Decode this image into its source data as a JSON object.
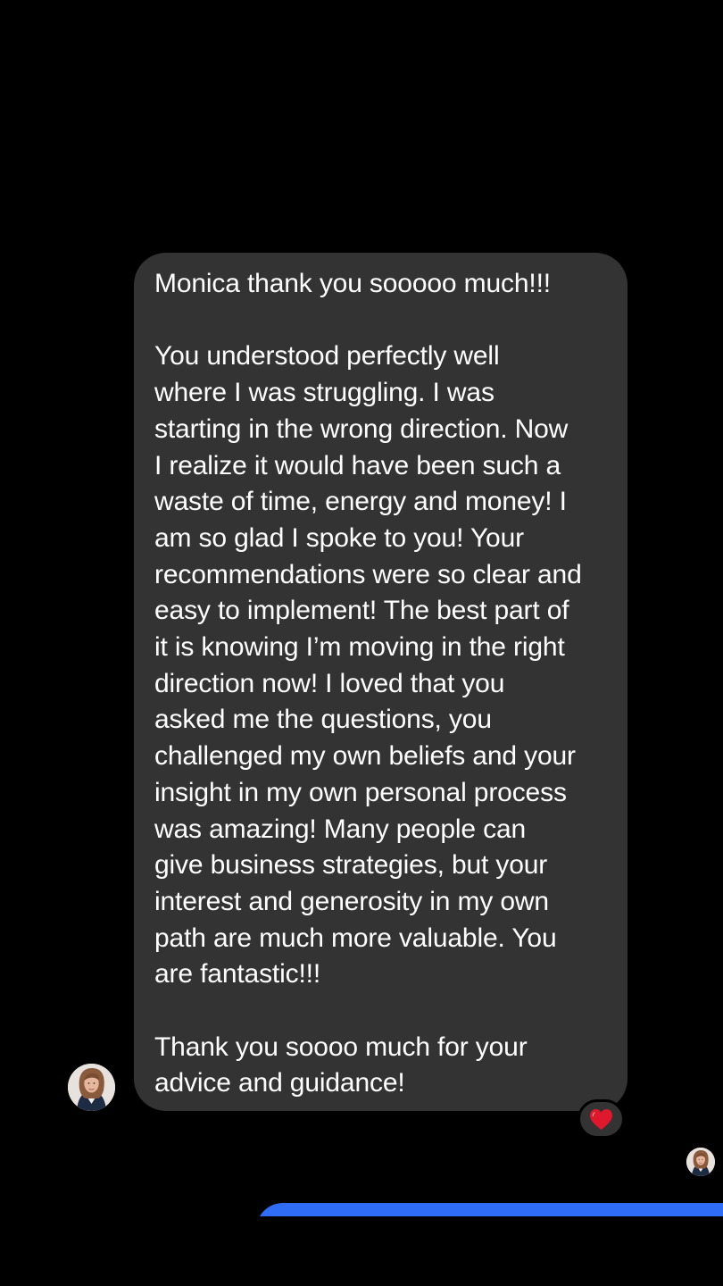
{
  "conversation": {
    "incoming_message": {
      "paragraph_1": "Monica thank you sooooo much!!!",
      "paragraph_2": "You understood perfectly well\nwhere I was struggling.  I was\nstarting in the wrong direction.  Now\nI realize it would have been such a\nwaste of time, energy and money!  I\nam so glad I spoke to you!  Your\nrecommendations were so clear and\neasy to implement!  The best part of\nit is knowing I’m moving in the right\ndirection now!  I loved that you\nasked me the questions, you\nchallenged my own beliefs and your\ninsight in my own personal process\nwas amazing!  Many people can\ngive business strategies, but your\ninterest and generosity in my own\npath are much more valuable.  You\nare fantastic!!!",
      "paragraph_3": "Thank you soooo much for your\nadvice and guidance!"
    },
    "reaction": {
      "icon": "red-heart-icon",
      "color": "#e0182d"
    },
    "colors": {
      "background": "#000000",
      "incoming_bubble": "#333333",
      "outgoing_bubble": "#2f6df6",
      "text": "#ffffff"
    }
  }
}
